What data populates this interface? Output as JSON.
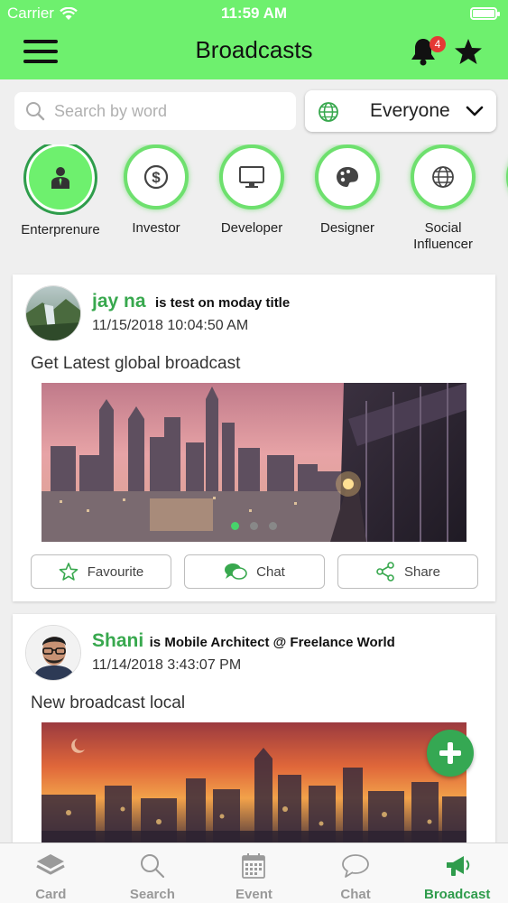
{
  "status_bar": {
    "carrier": "Carrier",
    "time": "11:59 AM",
    "battery_level": 0.95
  },
  "header": {
    "title": "Broadcasts",
    "notification_count": "4"
  },
  "search": {
    "placeholder": "Search by word",
    "value": ""
  },
  "audience": {
    "selected": "Everyone"
  },
  "categories": [
    {
      "label": "Enterprenure",
      "icon": "person-tie-icon",
      "active": true
    },
    {
      "label": "Investor",
      "icon": "dollar-icon",
      "active": false
    },
    {
      "label": "Developer",
      "icon": "monitor-icon",
      "active": false
    },
    {
      "label": "Designer",
      "icon": "palette-icon",
      "active": false
    },
    {
      "label": "Social Influencer",
      "icon": "globe-icon",
      "active": false
    }
  ],
  "posts": [
    {
      "author": "jay na",
      "role": "is test on moday title",
      "date": "11/15/2018 10:04:50 AM",
      "text": "Get Latest global broadcast",
      "image_icon": "city-skyline-photo",
      "carousel_pages": 3,
      "carousel_current": 1,
      "actions": {
        "favourite": "Favourite",
        "chat": "Chat",
        "share": "Share"
      }
    },
    {
      "author": "Shani",
      "role": "is Mobile Architect @ Freelance World",
      "date": "11/14/2018 3:43:07 PM",
      "text": "New broadcast local",
      "image_icon": "night-city-photo"
    }
  ],
  "tabs": [
    {
      "label": "Card",
      "icon": "layers-icon",
      "active": false
    },
    {
      "label": "Search",
      "icon": "search-icon",
      "active": false
    },
    {
      "label": "Event",
      "icon": "calendar-icon",
      "active": false
    },
    {
      "label": "Chat",
      "icon": "chat-bubble-icon",
      "active": false
    },
    {
      "label": "Broadcast",
      "icon": "megaphone-icon",
      "active": true
    }
  ],
  "colors": {
    "header": "#6ef06e",
    "accent": "#38a84e",
    "fab": "#35a853",
    "badge": "#e53935"
  }
}
